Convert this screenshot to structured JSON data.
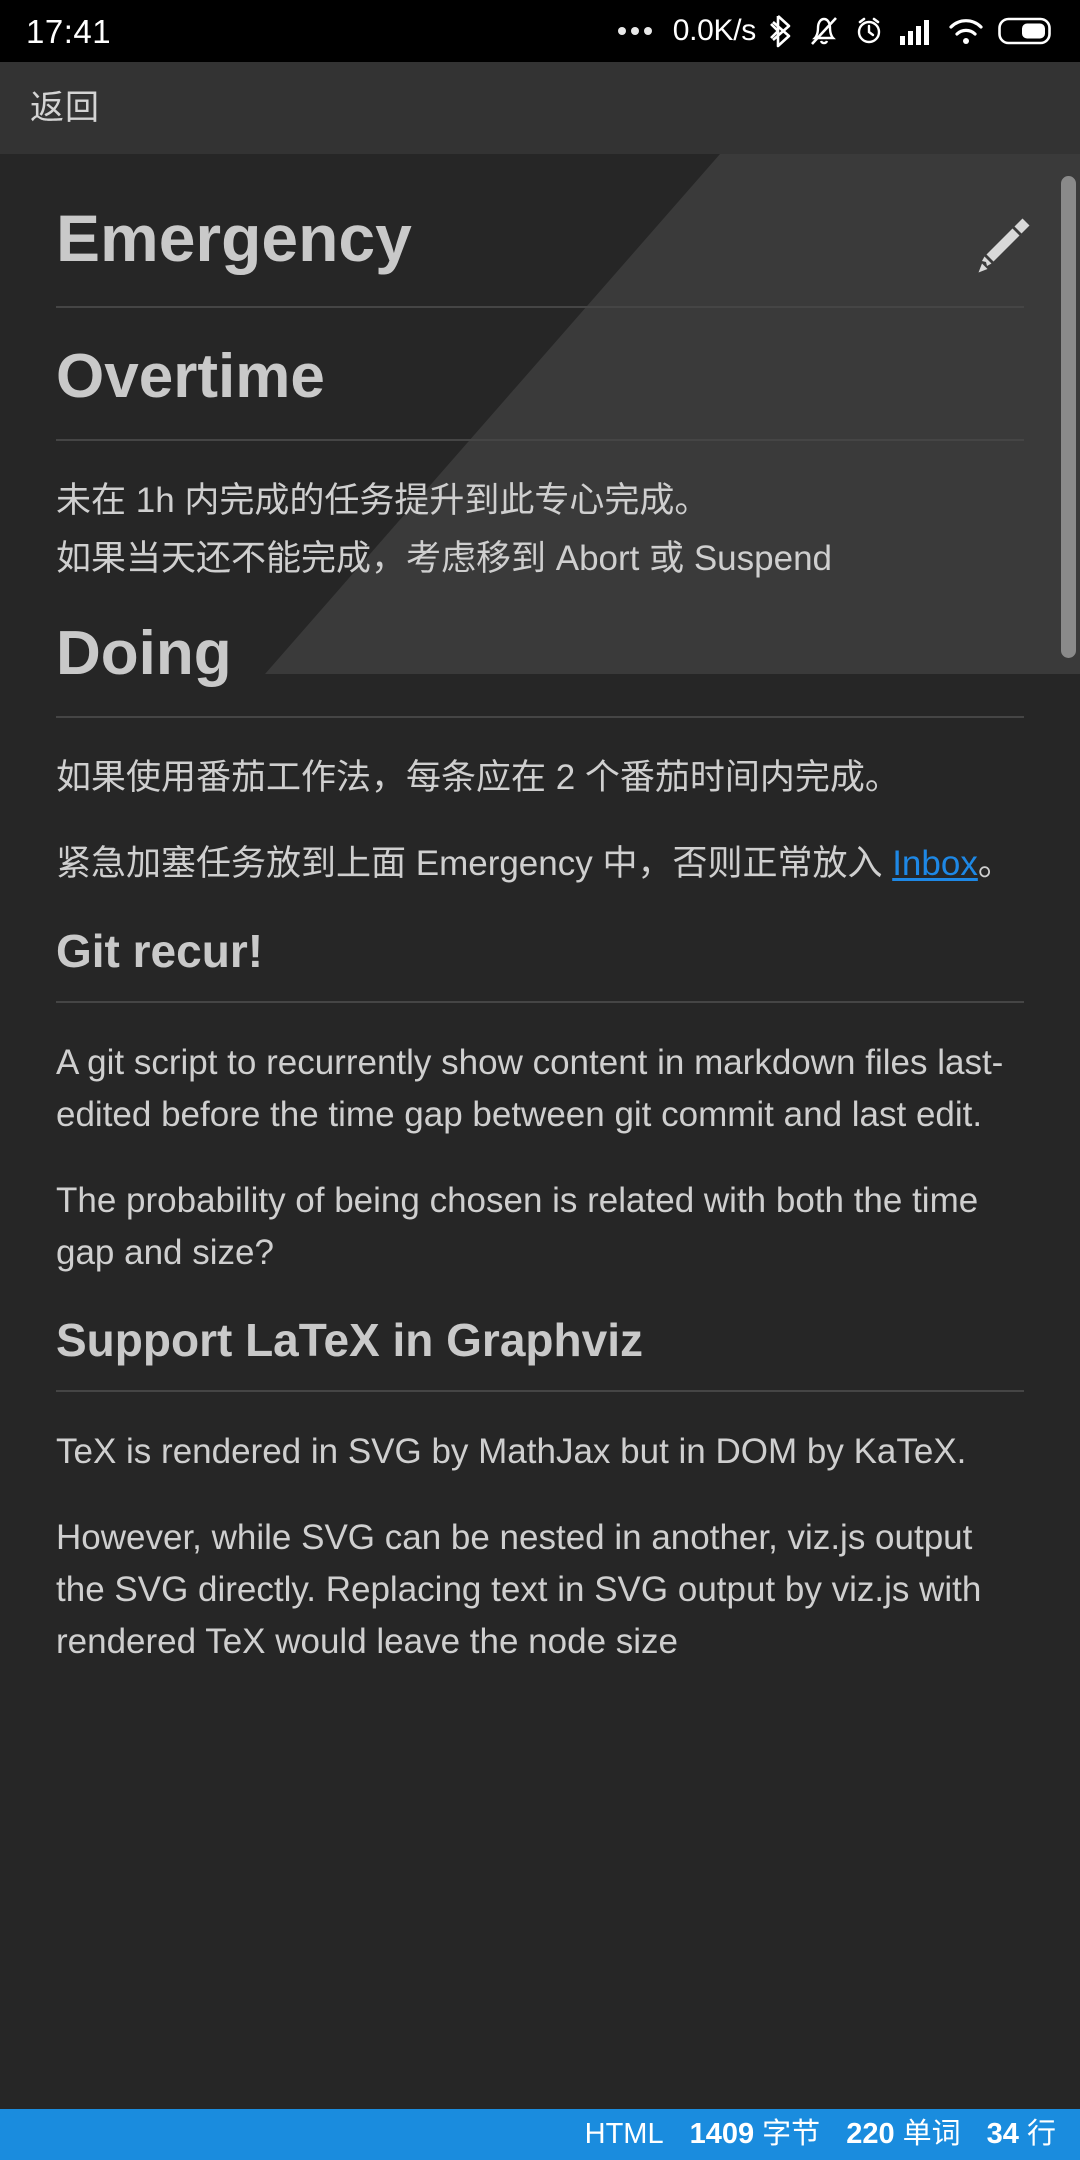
{
  "system_bar": {
    "clock": "17:41",
    "network_speed": "0.0K/s",
    "icons": [
      "more-dots-icon",
      "bluetooth-icon",
      "mute-bell-icon",
      "alarm-clock-icon",
      "signal-bars-icon",
      "wifi-icon",
      "battery-icon"
    ]
  },
  "app_bar": {
    "back_label": "返回"
  },
  "document": {
    "blocks": [
      {
        "type": "h1",
        "text": "Emergency"
      },
      {
        "type": "h2",
        "text": "Overtime"
      },
      {
        "type": "p",
        "text": "未在 1h 内完成的任务提升到此专心完成。"
      },
      {
        "type": "p",
        "text": "如果当天还不能完成，考虑移到 Abort 或 Suspend"
      },
      {
        "type": "h2",
        "text": "Doing"
      },
      {
        "type": "p",
        "text": "如果使用番茄工作法，每条应在 2 个番茄时间内完成。"
      },
      {
        "type": "p_link",
        "before": "紧急加塞任务放到上面 Emergency 中，否则正常放入 ",
        "link": "Inbox",
        "after": "。"
      },
      {
        "type": "h3",
        "text": "Git recur!"
      },
      {
        "type": "p",
        "text": "A git script to recurrently show content in markdown files last-edited before the time gap between git commit and last edit."
      },
      {
        "type": "p",
        "text": "The probability of being chosen is related with both the time gap and size?"
      },
      {
        "type": "h3",
        "text": "Support LaTeX in Graphviz"
      },
      {
        "type": "p",
        "text": "TeX is rendered in SVG by MathJax but in DOM by KaTeX."
      },
      {
        "type": "p",
        "text": "However, while SVG can be nested in another, viz.js output the SVG directly. Replacing text in SVG output by viz.js with rendered TeX would leave the node size"
      }
    ],
    "edit_icon": "pencil-icon"
  },
  "status_bar": {
    "filetype": "HTML",
    "bytes_value": "1409",
    "bytes_unit": "字节",
    "words_value": "220",
    "words_unit": "单词",
    "lines_value": "34",
    "lines_unit": "行"
  },
  "colors": {
    "accent": "#1a8cde",
    "link": "#1e88e5",
    "page_bg": "#262626",
    "appbar_bg": "#333333",
    "text": "#cfcfcf"
  }
}
